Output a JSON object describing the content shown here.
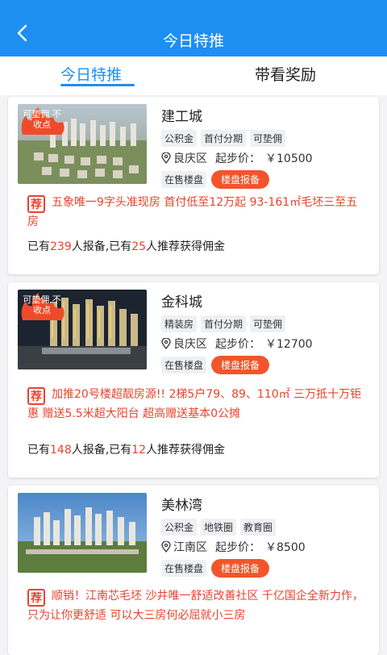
{
  "header": {
    "title": "今日特推",
    "back_icon": "chevron-left-icon"
  },
  "tabs": [
    {
      "label": "今日特推",
      "active": true
    },
    {
      "label": "带看奖励",
      "active": false
    }
  ],
  "colors": {
    "primary": "#1e8ff2",
    "accent": "#e8432d",
    "button": "#f2552c"
  },
  "common": {
    "price_label": "起步价：",
    "report_button": "楼盘报备",
    "promo_badge": "荐",
    "stats_prefix": "已有",
    "stats_mid": "人报备,已有",
    "stats_suffix": "人推荐获得佣金"
  },
  "listings": [
    {
      "name": "建工城",
      "badge": "可垫佣 不收点",
      "tags": [
        "公积金",
        "首付分期",
        "可垫佣"
      ],
      "district": "良庆区",
      "price": "￥10500",
      "status": "在售楼盘",
      "promo": "五象唯一9字头准现房 首付低至12万起 93-161㎡毛坯三至五房",
      "reports": "239",
      "recommends": "25"
    },
    {
      "name": "金科城",
      "badge": "可垫佣 不收点",
      "tags": [
        "精装房",
        "首付分期",
        "可垫佣"
      ],
      "district": "良庆区",
      "price": "￥12700",
      "status": "在售楼盘",
      "promo": "加推20号楼超靓房源!! 2梯5户79、89、110㎡ 三万抵十万钜惠 赠送5.5米超大阳台 超高赠送基本0公摊",
      "reports": "148",
      "recommends": "12"
    },
    {
      "name": "美林湾",
      "tags": [
        "公积金",
        "地铁圈",
        "教育圈"
      ],
      "district": "江南区",
      "price": "￥8500",
      "status": "在售楼盘",
      "promo": "顺销！江南芯毛坯 沙井唯一舒适改善社区 千亿国企全新力作，只为让你更舒适 可以大三房何必屈就小三房"
    }
  ]
}
